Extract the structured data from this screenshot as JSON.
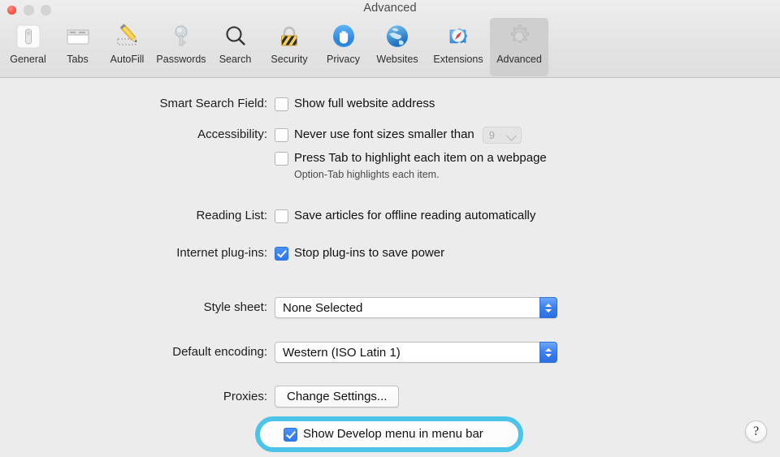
{
  "window": {
    "title": "Advanced",
    "traffic_lights": [
      {
        "name": "close",
        "color": "#f9574a"
      },
      {
        "name": "minimize",
        "color": "#d4d4d4"
      },
      {
        "name": "zoom",
        "color": "#d4d4d4"
      }
    ]
  },
  "toolbar": {
    "selected": "Advanced",
    "items": [
      {
        "label": "General",
        "icon": "general-icon"
      },
      {
        "label": "Tabs",
        "icon": "tabs-icon"
      },
      {
        "label": "AutoFill",
        "icon": "autofill-pencil-icon"
      },
      {
        "label": "Passwords",
        "icon": "key-icon"
      },
      {
        "label": "Search",
        "icon": "magnifier-icon"
      },
      {
        "label": "Security",
        "icon": "padlock-icon"
      },
      {
        "label": "Privacy",
        "icon": "hand-icon"
      },
      {
        "label": "Websites",
        "icon": "globe-icon"
      },
      {
        "label": "Extensions",
        "icon": "puzzle-compass-icon"
      },
      {
        "label": "Advanced",
        "icon": "gear-icon"
      }
    ]
  },
  "form": {
    "smart_search": {
      "label": "Smart Search Field:",
      "checkbox_label": "Show full website address",
      "checked": false
    },
    "accessibility": {
      "label": "Accessibility:",
      "font_size_label": "Never use font sizes smaller than",
      "font_size_checked": false,
      "font_size_value": "9",
      "font_size_enabled": false,
      "tab_highlight_label": "Press Tab to highlight each item on a webpage",
      "tab_highlight_checked": false,
      "hint": "Option-Tab highlights each item."
    },
    "reading_list": {
      "label": "Reading List:",
      "checkbox_label": "Save articles for offline reading automatically",
      "checked": false
    },
    "plugins": {
      "label": "Internet plug-ins:",
      "checkbox_label": "Stop plug-ins to save power",
      "checked": true
    },
    "style_sheet": {
      "label": "Style sheet:",
      "value": "None Selected"
    },
    "default_encoding": {
      "label": "Default encoding:",
      "value": "Western (ISO Latin 1)"
    },
    "proxies": {
      "label": "Proxies:",
      "button_label": "Change Settings..."
    },
    "develop": {
      "checkbox_label": "Show Develop menu in menu bar",
      "checked": true,
      "highlight_color": "#4cc3e9"
    }
  },
  "help": {
    "glyph": "?"
  }
}
